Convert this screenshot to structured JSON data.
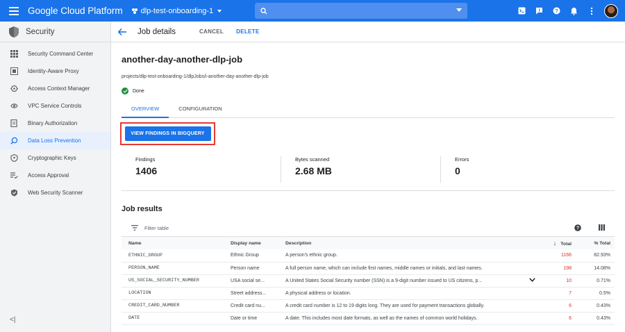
{
  "topbar": {
    "brand": "Google Cloud Platform",
    "project": "dlp-test-onboarding-1",
    "accent": "#1a73e8"
  },
  "sidebar": {
    "title": "Security",
    "items": [
      {
        "label": "Security Command Center",
        "icon": "grid-icon"
      },
      {
        "label": "Identity-Aware Proxy",
        "icon": "proxy-icon"
      },
      {
        "label": "Access Context Manager",
        "icon": "context-icon"
      },
      {
        "label": "VPC Service Controls",
        "icon": "vpc-icon"
      },
      {
        "label": "Binary Authorization",
        "icon": "binary-icon"
      },
      {
        "label": "Data Loss Prevention",
        "icon": "dlp-icon",
        "active": true
      },
      {
        "label": "Cryptographic Keys",
        "icon": "key-icon"
      },
      {
        "label": "Access Approval",
        "icon": "approval-icon"
      },
      {
        "label": "Web Security Scanner",
        "icon": "scanner-icon"
      }
    ],
    "collapse": "<|"
  },
  "header": {
    "title": "Job details",
    "cancel": "CANCEL",
    "delete": "DELETE"
  },
  "job": {
    "name": "another-day-another-dlp-job",
    "path": "projects/dlp-test-onboarding-1/dlpJobs/i-another-day-another-dlp-job",
    "status": "Done"
  },
  "tabs": [
    "OVERVIEW",
    "CONFIGURATION"
  ],
  "cta": "VIEW FINDINGS IN BIGQUERY",
  "stats": [
    {
      "label": "Findings",
      "value": "1406"
    },
    {
      "label": "Bytes scanned",
      "value": "2.68 MB"
    },
    {
      "label": "Errors",
      "value": "0"
    }
  ],
  "results": {
    "title": "Job results",
    "filter_placeholder": "Filter table",
    "columns": [
      "Name",
      "Display name",
      "Description",
      "Total",
      "% Total"
    ],
    "rows": [
      {
        "name": "ETHNIC_GROUP",
        "display": "Ethnic Group",
        "desc": "A person's ethnic group.",
        "total": "1166",
        "pct": "82.93%"
      },
      {
        "name": "PERSON_NAME",
        "display": "Person name",
        "desc": "A full person name, which can include first names, middle names or initials, and last names.",
        "total": "198",
        "pct": "14.08%"
      },
      {
        "name": "US_SOCIAL_SECURITY_NUMBER",
        "display": "USA social se...",
        "desc": "A United States Social Security number (SSN) is a 9-digit number issued to US citizens, p...",
        "total": "10",
        "pct": "0.71%"
      },
      {
        "name": "LOCATION",
        "display": "Street address...",
        "desc": "A physical address or location.",
        "total": "7",
        "pct": "0.5%"
      },
      {
        "name": "CREDIT_CARD_NUMBER",
        "display": "Credit card nu...",
        "desc": "A credit card number is 12 to 19 digits long. They are used for payment transactions globally.",
        "total": "6",
        "pct": "0.43%"
      },
      {
        "name": "DATE",
        "display": "Date or time",
        "desc": "A date. This includes most date formats, as well as the names of common world holidays.",
        "total": "6",
        "pct": "0.43%"
      }
    ]
  }
}
